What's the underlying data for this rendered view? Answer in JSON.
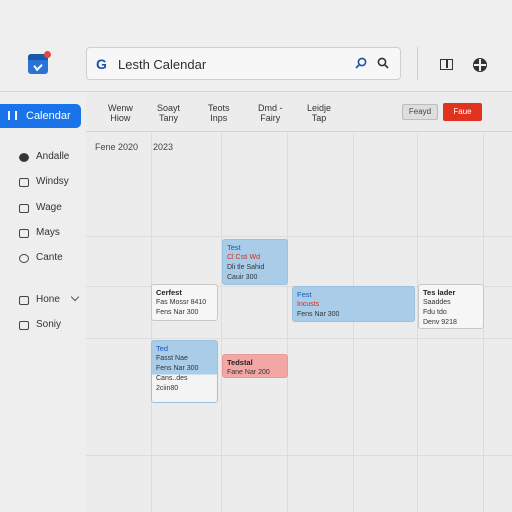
{
  "header": {
    "google_mark": "G",
    "search_title": "Lesth Calendar"
  },
  "sidebar": {
    "active": "Calendar",
    "items": [
      "Andalle",
      "Windsy",
      "Wage",
      "Mays",
      "Cante",
      "Hone",
      "Soniy"
    ]
  },
  "views": [
    {
      "line1": "Wenw",
      "line2": "Hiow"
    },
    {
      "line1": "Soayt",
      "line2": "Tany"
    },
    {
      "line1": "Teots",
      "line2": "Inps"
    },
    {
      "line1": "Dmd -",
      "line2": "Fairy"
    },
    {
      "line1": "Leidje",
      "line2": "Tap"
    }
  ],
  "buttons": {
    "secondary": "Feayd",
    "primary": "Faue"
  },
  "dates": [
    "Fene 2020",
    "2023"
  ],
  "events": [
    {
      "title": "Test",
      "lines": [
        "Cl Csti Wd",
        "Dli tle Sahid",
        "Cauir 300"
      ],
      "red_line": 0
    },
    {
      "title": "Cerfest",
      "lines": [
        "Fas Mossr 8410",
        "Fens Nar 300"
      ],
      "red_line": -1
    },
    {
      "title": "Fest",
      "lines": [
        "Incusts",
        "Fens Nar 300"
      ],
      "red_line": 0
    },
    {
      "title": "Tes lader",
      "lines": [
        "Saaddes",
        "Fdu tdo",
        "Denv 9218"
      ],
      "red_line": -1
    },
    {
      "title": "Ted",
      "lines": [
        "Fasst Nae",
        "Fens Nar 300",
        "",
        "Cans..des",
        "2ciin80"
      ],
      "red_line": -1
    },
    {
      "title": "Tedstal",
      "lines": [
        "Fane Nar 200"
      ],
      "red_line": -1
    }
  ]
}
